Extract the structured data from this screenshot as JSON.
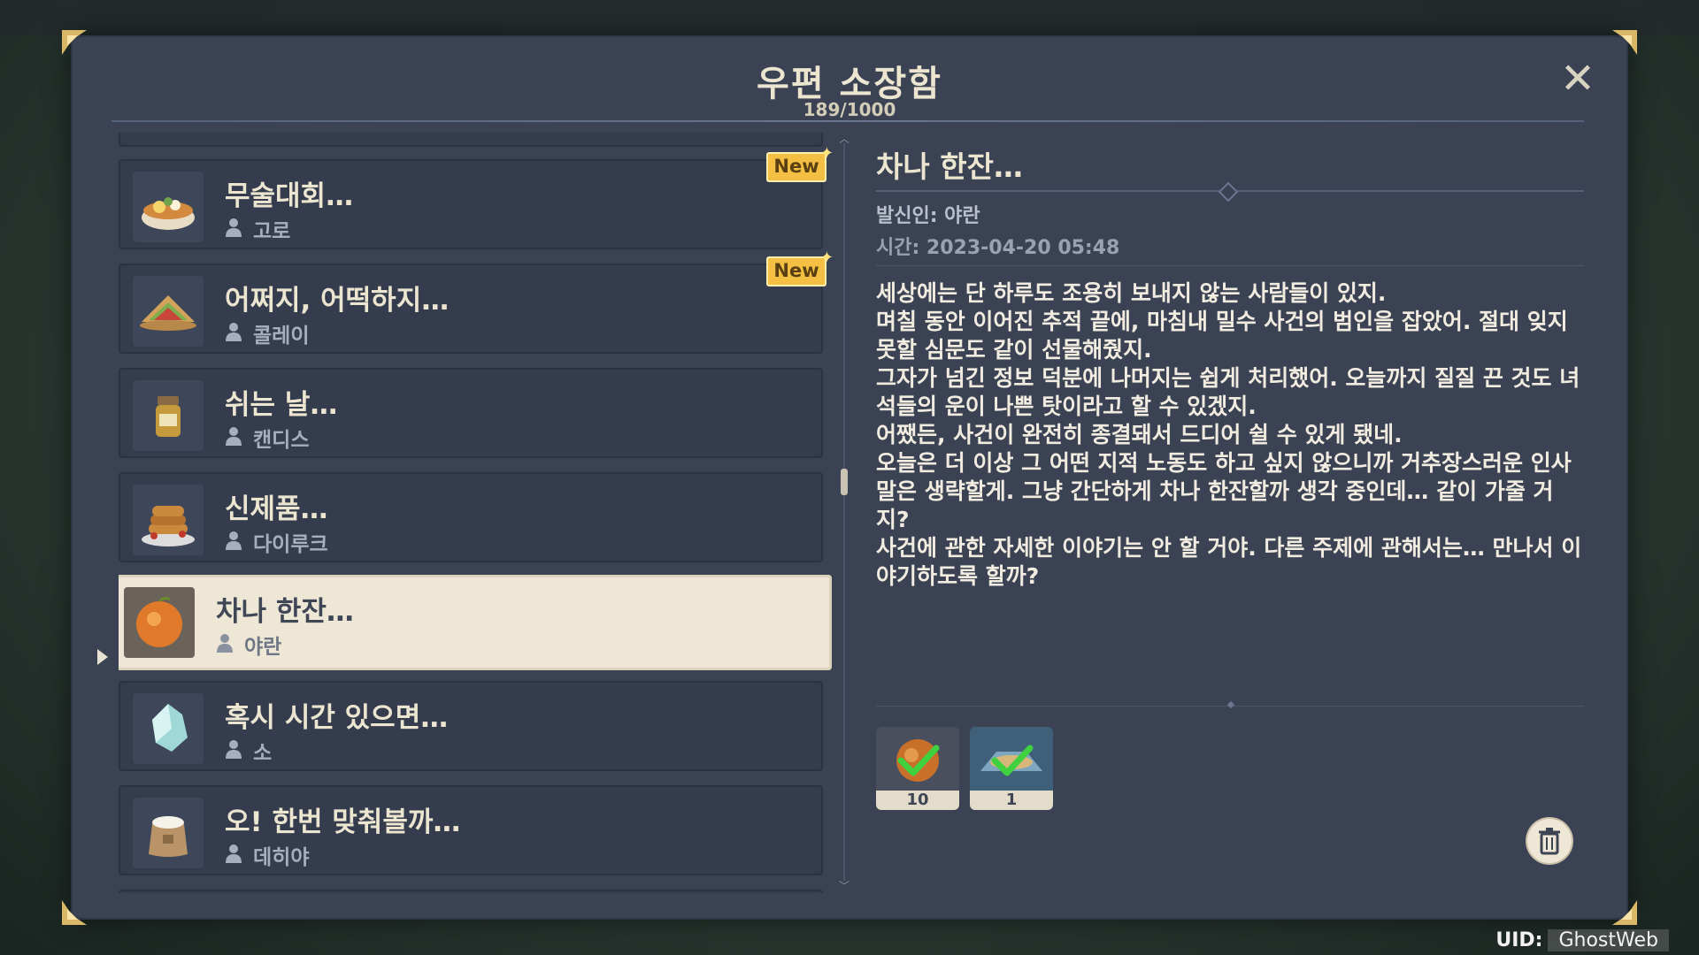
{
  "window": {
    "title": "우편 소장함",
    "count": "189/1000"
  },
  "mail_list": [
    {
      "title": "무술대회…",
      "sender": "고로",
      "badge": "New",
      "icon": "ramen-bowl-icon",
      "selected": false
    },
    {
      "title": "어쩌지, 어떡하지…",
      "sender": "콜레이",
      "badge": "New",
      "icon": "wrap-sandwich-icon",
      "selected": false
    },
    {
      "title": "쉬는 날…",
      "sender": "캔디스",
      "badge": "",
      "icon": "spice-jar-icon",
      "selected": false
    },
    {
      "title": "신제품…",
      "sender": "다이루크",
      "badge": "",
      "icon": "pancake-stack-icon",
      "selected": false
    },
    {
      "title": "차나 한잔…",
      "sender": "야란",
      "badge": "",
      "icon": "orange-fruit-icon",
      "selected": true
    },
    {
      "title": "혹시 시간 있으면…",
      "sender": "소",
      "badge": "",
      "icon": "crystal-chunk-icon",
      "selected": false
    },
    {
      "title": "오! 한번 맞춰볼까…",
      "sender": "데히야",
      "badge": "",
      "icon": "flour-sack-icon",
      "selected": false
    }
  ],
  "detail": {
    "title": "차나 한잔…",
    "sender_line": "발신인: 야란",
    "time_line": "시간: 2023-04-20 05:48",
    "body": "세상에는 단 하루도 조용히 보내지 않는 사람들이 있지.\n며칠 동안 이어진 추적 끝에, 마침내 밀수 사건의 범인을 잡았어. 절대 잊지 못할 심문도 같이 선물해줬지.\n그자가 넘긴 정보 덕분에 나머지는 쉽게 처리했어. 오늘까지 질질 끈 것도 녀석들의 운이 나쁜 탓이라고 할 수 있겠지.\n어쨌든, 사건이 완전히 종결돼서 드디어 쉴 수 있게 됐네.\n오늘은 더 이상 그 어떤 지적 노동도 하고 싶지 않으니까 거추장스러운 인사말은 생략할게. 그냥 간단하게 차나 한잔할까 생각 중인데… 같이 가줄 거지?\n사건에 관한 자세한 이야기는 안 할 거야. 다른 주제에 관해서는… 만나서 이야기하도록 할까?",
    "attachments": [
      {
        "quantity": "10",
        "icon": "orange-fruit-icon",
        "claimed": true
      },
      {
        "quantity": "1",
        "icon": "food-platter-icon",
        "claimed": true
      }
    ]
  },
  "uid": {
    "label": "UID:",
    "value": "GhostWeb"
  },
  "colors": {
    "panel": "#3a4254",
    "item": "#343c4e",
    "selected": "#efe7d6",
    "badge": "#f3c043",
    "text_light": "#ece5d0",
    "check": "#3fd13f"
  }
}
